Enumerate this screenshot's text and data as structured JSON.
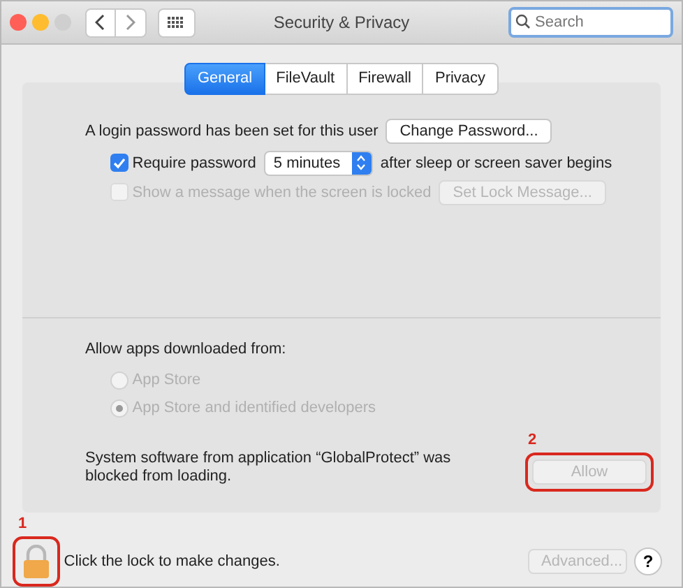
{
  "window": {
    "title": "Security & Privacy"
  },
  "search": {
    "placeholder": "Search"
  },
  "tabs": [
    {
      "label": "General",
      "selected": true
    },
    {
      "label": "FileVault",
      "selected": false
    },
    {
      "label": "Firewall",
      "selected": false
    },
    {
      "label": "Privacy",
      "selected": false
    }
  ],
  "login": {
    "text": "A login password has been set for this user",
    "button": "Change Password..."
  },
  "require_password": {
    "label": "Require password",
    "checked": true,
    "delay": "5 minutes",
    "suffix": "after sleep or screen saver begins"
  },
  "lock_message": {
    "label": "Show a message when the screen is locked",
    "checked": false,
    "disabled": true,
    "button": "Set Lock Message..."
  },
  "allow_apps": {
    "label": "Allow apps downloaded from:",
    "options": [
      {
        "label": "App Store",
        "selected": false,
        "disabled": true
      },
      {
        "label": "App Store and identified developers",
        "selected": true,
        "disabled": true
      }
    ]
  },
  "blocked": {
    "text": "System software from application “GlobalProtect” was blocked from loading.",
    "button": "Allow",
    "disabled": true,
    "callout": "2"
  },
  "lock": {
    "text": "Click the lock to make changes.",
    "callout": "1"
  },
  "advanced": {
    "label": "Advanced...",
    "disabled": true
  },
  "help": {
    "label": "?"
  }
}
